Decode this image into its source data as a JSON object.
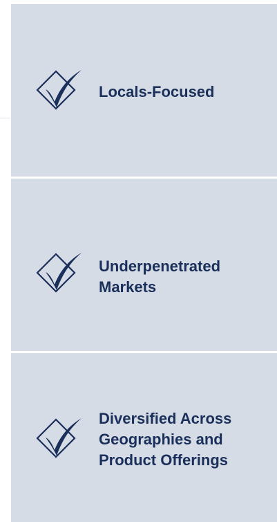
{
  "items": [
    {
      "label": "Locals-Focused",
      "icon": "check-diamond-icon"
    },
    {
      "label": "Underpenetrated\nMarkets",
      "icon": "check-diamond-icon"
    },
    {
      "label": "Diversified Across\nGeographies and\nProduct Offerings",
      "icon": "check-diamond-icon"
    }
  ],
  "colors": {
    "panel_background": "#d6dce6",
    "text": "#1a2f5a",
    "icon": "#1a2f5a"
  }
}
